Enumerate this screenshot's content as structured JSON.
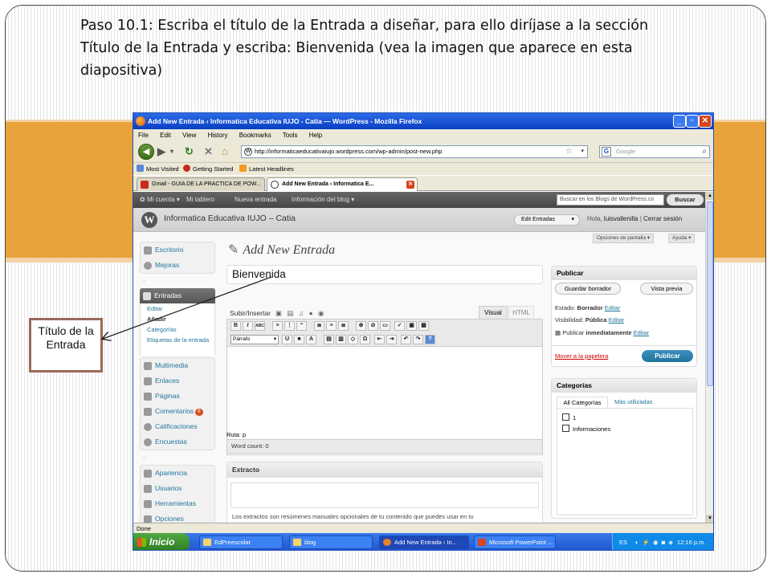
{
  "slide": {
    "title": "Paso 10.1: Escriba el título de la Entrada a diseñar, para ello diríjase a la sección Título de la Entrada y escriba: Bienvenida  (vea la imagen que aparece en esta diapositiva)",
    "callout": "Título de la Entrada"
  },
  "browser": {
    "window_title": "Add New Entrada ‹ Informatica Educativa IUJO - Catia — WordPress - Mozilla Firefox",
    "menu": [
      "File",
      "Edit",
      "View",
      "History",
      "Bookmarks",
      "Tools",
      "Help"
    ],
    "url": "http://informaticaeducativaiujo.wordpress.com/wp-admin/post-new.php",
    "search_placeholder": "Google",
    "bookmarks": [
      "Most Visited",
      "Getting Started",
      "Latest Headlines"
    ],
    "tabs": [
      "Gmail - GUIA DE LA PRACTICA DE POW...",
      "Add New Entrada ‹ Informatica E..."
    ],
    "status": "Done"
  },
  "wp": {
    "adminbar": [
      "Mi cuenta ▾",
      "Mi tablero",
      "Nueva entrada",
      "Información del blog ▾"
    ],
    "search_placeholder": "Buscar en los Blogs de WordPress.co",
    "search_button": "Buscar",
    "blog_name": "Informatica Educativa IUJO – Catia",
    "edit_menu": "Edit Entradas",
    "greeting": "Hola,",
    "user": "luisvallenilla",
    "logout": "Cerrar sesión",
    "screen_options": "Opciones de pantalla ▾",
    "help": "Ayuda ▾",
    "page_heading": "Add New Entrada",
    "title_value": "Bienvenida",
    "menu": {
      "escritorio": "Escritorio",
      "mejoras": "Mejoras",
      "entradas": "Entradas",
      "sub": [
        "Editar",
        "Añadir",
        "Categorías",
        "Etiquetas de la entrada"
      ],
      "group2": [
        "Multimedia",
        "Enlaces",
        "Páginas",
        "Comentarios",
        "Calificaciones",
        "Encuestas"
      ],
      "comments_badge": "6",
      "group3": [
        "Apariencia",
        "Usuarios",
        "Herramientas",
        "Opciones"
      ]
    },
    "editor": {
      "upload_label": "Subir/Insertar",
      "tab_visual": "Visual",
      "tab_html": "HTML",
      "format": "Párrafo",
      "path": "Ruta: p",
      "word_count": "Word count: 0"
    },
    "excerpt": {
      "title": "Extracto",
      "help": "Los extractos son resúmenes manuales opcionales de tu contenido que puedes usar en tu"
    },
    "publish": {
      "title": "Publicar",
      "save_draft": "Guardar borrador",
      "preview": "Vista previa",
      "status_label": "Estado:",
      "status_value": "Borrador",
      "visibility_label": "Visibilidad:",
      "visibility_value": "Pública",
      "publish_label": "Publicar",
      "publish_value": "inmediatamente",
      "edit": "Editar",
      "trash": "Mover a la papelera",
      "publish_button": "Publicar"
    },
    "categories": {
      "title": "Categorías",
      "tab_all": "All Categorías",
      "tab_popular": "Más utilizadas",
      "items": [
        "1",
        "Informaciones"
      ]
    }
  },
  "taskbar": {
    "start": "Inicio",
    "items": [
      "EdPreescolar",
      "blog",
      "Add New Entrada ‹ In...",
      "Microsoft PowerPoint ..."
    ],
    "lang": "ES",
    "time": "12:16 p.m."
  }
}
